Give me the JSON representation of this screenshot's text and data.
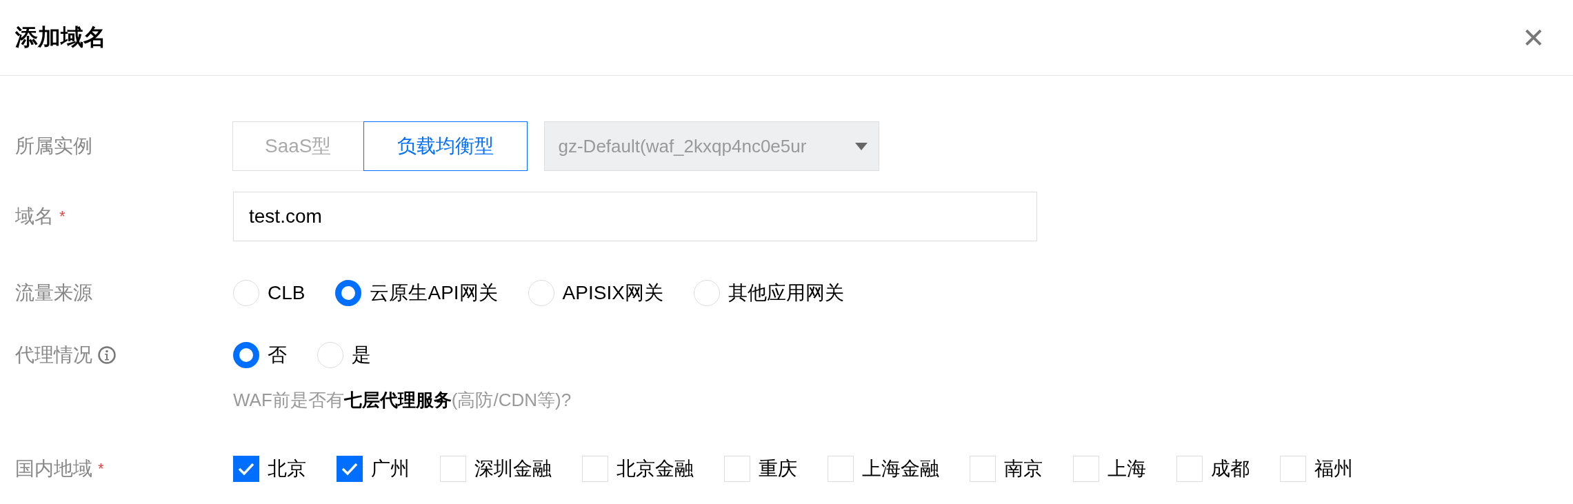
{
  "dialog": {
    "title": "添加域名",
    "close": "✕"
  },
  "instance": {
    "label": "所属实例",
    "options": [
      {
        "label": "SaaS型",
        "selected": false
      },
      {
        "label": "负载均衡型",
        "selected": true
      }
    ],
    "select": {
      "value": "gz-Default(waf_2kxqp4nc0e5ur",
      "disabled": true
    }
  },
  "domain": {
    "label": "域名",
    "required_mark": "*",
    "value": "test.com"
  },
  "traffic_source": {
    "label": "流量来源",
    "options": [
      {
        "label": "CLB",
        "selected": false
      },
      {
        "label": "云原生API网关",
        "selected": true
      },
      {
        "label": "APISIX网关",
        "selected": false
      },
      {
        "label": "其他应用网关",
        "selected": false
      }
    ]
  },
  "proxy": {
    "label": "代理情况",
    "options": [
      {
        "label": "否",
        "selected": true
      },
      {
        "label": "是",
        "selected": false
      }
    ],
    "hint": "WAF前是否有**七层代理服务**(高防/CDN等)?"
  },
  "regions": {
    "label": "国内地域",
    "required_mark": "*",
    "items": [
      {
        "label": "北京",
        "checked": true
      },
      {
        "label": "广州",
        "checked": true
      },
      {
        "label": "深圳金融",
        "checked": false
      },
      {
        "label": "北京金融",
        "checked": false
      },
      {
        "label": "重庆",
        "checked": false
      },
      {
        "label": "上海金融",
        "checked": false
      },
      {
        "label": "南京",
        "checked": false
      },
      {
        "label": "上海",
        "checked": false
      },
      {
        "label": "成都",
        "checked": false
      },
      {
        "label": "福州",
        "checked": false
      }
    ]
  }
}
